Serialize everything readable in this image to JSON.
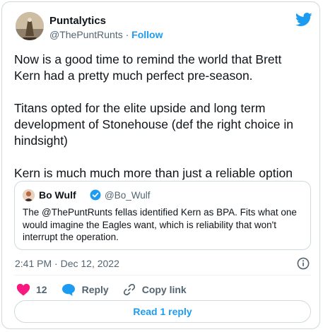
{
  "author": {
    "name": "Puntalytics",
    "handle": "@ThePuntRunts",
    "separator": " · ",
    "follow_label": "Follow"
  },
  "tweet": {
    "paragraphs": [
      "Now is a good time to remind the world that Brett Kern had a pretty much perfect pre-season.",
      "Titans opted for the elite upside and long term development of Stonehouse (def the right choice in hindsight)",
      "Kern is much much more than just a reliable option"
    ]
  },
  "quote": {
    "name": "Bo Wulf",
    "handle": "@Bo_Wulf",
    "text": "The @ThePuntRunts fellas identified Kern as BPA. Fits what one would imagine the Eagles want, which is reliability that won't interrupt the operation."
  },
  "timestamp": "2:41 PM · Dec 12, 2022",
  "actions": {
    "like_count": "12",
    "reply_label": "Reply",
    "copy_link_label": "Copy link"
  },
  "read_replies_label": "Read 1 reply",
  "colors": {
    "accent": "#1d9bf0",
    "like": "#f91880",
    "secondary_text": "#536471",
    "border": "#cfd9de"
  },
  "icons": [
    "twitter-bird-icon",
    "verified-badge-icon",
    "info-icon",
    "heart-icon",
    "reply-bubble-icon",
    "link-icon"
  ]
}
